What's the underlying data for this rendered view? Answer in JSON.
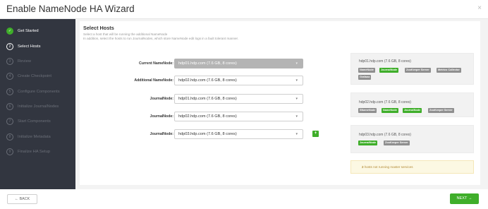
{
  "header": {
    "title": "Enable NameNode HA Wizard",
    "close": "×"
  },
  "sidebar": {
    "steps": [
      {
        "num": "✓",
        "label": "Get Started",
        "state": "done"
      },
      {
        "num": "2",
        "label": "Select Hosts",
        "state": "current"
      },
      {
        "num": "3",
        "label": "Review",
        "state": "pending"
      },
      {
        "num": "4",
        "label": "Create Checkpoint",
        "state": "pending"
      },
      {
        "num": "5",
        "label": "Configure Components",
        "state": "pending"
      },
      {
        "num": "6",
        "label": "Initialize JournalNodes",
        "state": "pending"
      },
      {
        "num": "7",
        "label": "Start Components",
        "state": "pending"
      },
      {
        "num": "8",
        "label": "Initialize Metadata",
        "state": "pending"
      },
      {
        "num": "9",
        "label": "Finalize HA Setup",
        "state": "pending"
      }
    ]
  },
  "main": {
    "title": "Select Hosts",
    "desc1": "Select a host that will be running the additional NameNode",
    "desc2": "In addition, select the hosts to run JournalNodes, which store NameNode edit logs in a fault tolerant manner.",
    "fields": [
      {
        "label": "Current NameNode:",
        "value": "hdp01.hdp.com (7.6 GB, 8 cores)",
        "disabled": true
      },
      {
        "label": "Additional NameNode:",
        "value": "hdp02.hdp.com (7.6 GB, 8 cores)"
      },
      {
        "label": "JournalNode:",
        "value": "hdp01.hdp.com (7.6 GB, 8 cores)"
      },
      {
        "label": "JournalNode:",
        "value": "hdp02.hdp.com (7.6 GB, 8 cores)"
      },
      {
        "label": "JournalNode:",
        "value": "hdp03.hdp.com (7.6 GB, 8 cores)"
      }
    ],
    "add_button": "+",
    "hosts": [
      {
        "name": "hdp01.hdp.com (7.6 GB, 8 cores)",
        "components": [
          {
            "label": "NameNode",
            "color": "#8f8f8f"
          },
          {
            "label": "JournalNode",
            "color": "#3fae2a"
          },
          {
            "label": "ZooKeeper Server",
            "color": "#8f8f8f"
          },
          {
            "label": "Metrics Collector",
            "color": "#8f8f8f"
          },
          {
            "label": "Grafana",
            "color": "#8f8f8f"
          }
        ]
      },
      {
        "name": "hdp02.hdp.com (7.6 GB, 8 cores)",
        "components": [
          {
            "label": "SNameNode",
            "color": "#8f8f8f"
          },
          {
            "label": "NameNode",
            "color": "#3fae2a"
          },
          {
            "label": "JournalNode",
            "color": "#3fae2a"
          },
          {
            "label": "ZooKeeper Server",
            "color": "#8f8f8f"
          }
        ]
      },
      {
        "name": "hdp03.hdp.com (7.6 GB, 8 cores)",
        "components": [
          {
            "label": "JournalNode",
            "color": "#3fae2a"
          },
          {
            "label": "ZooKeeper Server",
            "color": "#8f8f8f"
          }
        ]
      }
    ],
    "warning": {
      "count": "2",
      "text": "hosts not running master services"
    }
  },
  "footer": {
    "back": "← BACK",
    "next": "NEXT →"
  },
  "colors": {
    "accent": "#3fae2a",
    "sidebar": "#323640",
    "badge_gray": "#8f8f8f"
  }
}
